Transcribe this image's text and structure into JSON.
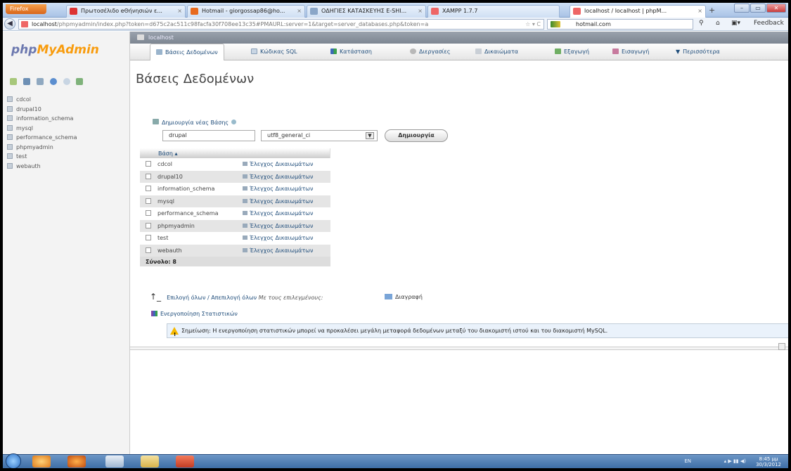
{
  "browser": {
    "firefox_button": "Firefox",
    "tabs": [
      {
        "label": "Πρωτοσέλιδο eΘήνησιών ε...",
        "icon": "newspaper-icon",
        "color": "#d33"
      },
      {
        "label": "Hotmail - giorgossap86@ho...",
        "icon": "hotmail-icon",
        "color": "#e86a1e"
      },
      {
        "label": "ΟΔΗΓΙΕΣ ΚΑΤΑΣΚΕΥΗΣ E-SHI...",
        "icon": "page-icon",
        "color": "#8aa6c8"
      },
      {
        "label": "XAMPP 1.7.7",
        "icon": "xampp-icon",
        "color": "#e66"
      },
      {
        "label": "localhost / localhost | phpM...",
        "icon": "phpmyadmin-icon",
        "color": "#e66"
      }
    ],
    "newtab_label": "+",
    "url_host": "localhost",
    "url_rest": "/phpmyadmin/index.php?token=d675c2ac511c98facfa30f708ee13c35#PMAURL:server=1&target=server_databases.php&token=a",
    "search_text": "hotmail.com",
    "feedback_label": "Feedback",
    "window_buttons": [
      "–",
      "▭",
      "✕"
    ]
  },
  "pma": {
    "logo_php": "php",
    "logo_myadmin": "MyAdmin",
    "sidebar_databases": [
      "cdcol",
      "drupal10",
      "information_schema",
      "mysql",
      "performance_schema",
      "phpmyadmin",
      "test",
      "webauth"
    ],
    "server_label": "localhost",
    "menu_tabs": [
      {
        "label": "Βάσεις Δεδομένων",
        "icon": "database-icon"
      },
      {
        "label": "Κώδικας SQL",
        "icon": "sql-icon"
      },
      {
        "label": "Κατάσταση",
        "icon": "status-icon"
      },
      {
        "label": "Διεργασίες",
        "icon": "processes-icon"
      },
      {
        "label": "Δικαιώματα",
        "icon": "privileges-icon"
      },
      {
        "label": "Εξαγωγή",
        "icon": "export-icon"
      },
      {
        "label": "Εισαγωγή",
        "icon": "import-icon"
      },
      {
        "label": "Περισσότερα",
        "icon": "more-icon"
      }
    ],
    "page_title": "Βάσεις Δεδομένων",
    "create_label": "Δημιουργία νέας Βάσης",
    "create_db_value": "drupal",
    "collation_value": "utf8_general_ci",
    "create_button": "Δημιουργία",
    "table_header": "Βάση",
    "privileges_link": "Έλεγχος Δικαιωμάτων",
    "total_label": "Σύνολο: 8",
    "check_all_text": "Επιλογή όλων / Απεπιλογή όλων",
    "with_selected_text": "Με τους επιλεγμένους:",
    "delete_label": "Διαγραφή",
    "enable_stats_label": "Ενεργοποίηση Στατιστικών",
    "notice_text": "Σημείωση: Η ενεργοποίηση στατιστικών μπορεί να προκαλέσει μεγάλη μεταφορά δεδομένων μεταξύ του διακομιστή ιστού και του διακομιστή MySQL."
  },
  "taskbar": {
    "tray_lang": "EN",
    "clock_time": "8:45 μμ",
    "clock_date": "30/3/2012"
  }
}
